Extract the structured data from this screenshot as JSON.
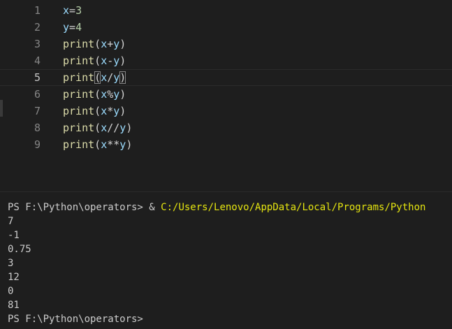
{
  "editor": {
    "active_line": 5,
    "lines": [
      {
        "number": "1",
        "tokens": [
          {
            "t": "x",
            "c": "v"
          },
          {
            "t": "=",
            "c": "o"
          },
          {
            "t": "3",
            "c": "n"
          }
        ]
      },
      {
        "number": "2",
        "tokens": [
          {
            "t": "y",
            "c": "v"
          },
          {
            "t": "=",
            "c": "o"
          },
          {
            "t": "4",
            "c": "n"
          }
        ]
      },
      {
        "number": "3",
        "tokens": [
          {
            "t": "print",
            "c": "f"
          },
          {
            "t": "(",
            "c": "p"
          },
          {
            "t": "x",
            "c": "v"
          },
          {
            "t": "+",
            "c": "o"
          },
          {
            "t": "y",
            "c": "v"
          },
          {
            "t": ")",
            "c": "p"
          }
        ]
      },
      {
        "number": "4",
        "tokens": [
          {
            "t": "print",
            "c": "f"
          },
          {
            "t": "(",
            "c": "p"
          },
          {
            "t": "x",
            "c": "v"
          },
          {
            "t": "-",
            "c": "o"
          },
          {
            "t": "y",
            "c": "v"
          },
          {
            "t": ")",
            "c": "p"
          }
        ]
      },
      {
        "number": "5",
        "tokens": [
          {
            "t": "print",
            "c": "f"
          },
          {
            "t": "(",
            "c": "p",
            "hl": true
          },
          {
            "t": "x",
            "c": "v"
          },
          {
            "t": "/",
            "c": "o"
          },
          {
            "t": "y",
            "c": "v"
          },
          {
            "t": ")",
            "c": "p",
            "hl": true
          }
        ]
      },
      {
        "number": "6",
        "tokens": [
          {
            "t": "print",
            "c": "f"
          },
          {
            "t": "(",
            "c": "p"
          },
          {
            "t": "x",
            "c": "v"
          },
          {
            "t": "%",
            "c": "o"
          },
          {
            "t": "y",
            "c": "v"
          },
          {
            "t": ")",
            "c": "p"
          }
        ]
      },
      {
        "number": "7",
        "tokens": [
          {
            "t": "print",
            "c": "f"
          },
          {
            "t": "(",
            "c": "p"
          },
          {
            "t": "x",
            "c": "v"
          },
          {
            "t": "*",
            "c": "o"
          },
          {
            "t": "y",
            "c": "v"
          },
          {
            "t": ")",
            "c": "p"
          }
        ]
      },
      {
        "number": "8",
        "tokens": [
          {
            "t": "print",
            "c": "f"
          },
          {
            "t": "(",
            "c": "p"
          },
          {
            "t": "x",
            "c": "v"
          },
          {
            "t": "//",
            "c": "o"
          },
          {
            "t": "y",
            "c": "v"
          },
          {
            "t": ")",
            "c": "p"
          }
        ]
      },
      {
        "number": "9",
        "tokens": [
          {
            "t": "print",
            "c": "f"
          },
          {
            "t": "(",
            "c": "p"
          },
          {
            "t": "x",
            "c": "v"
          },
          {
            "t": "**",
            "c": "o"
          },
          {
            "t": "y",
            "c": "v"
          },
          {
            "t": ")",
            "c": "p"
          }
        ]
      }
    ]
  },
  "terminal": {
    "prompt": "PS F:\\Python\\operators> ",
    "command_operator": "& ",
    "command_path": "C:/Users/Lenovo/AppData/Local/Programs/Python",
    "outputs": [
      "7",
      "-1",
      "0.75",
      "3",
      "12",
      "0",
      "81"
    ],
    "final_prompt": "PS F:\\Python\\operators>"
  },
  "colors": {
    "background": "#1e1e1e",
    "variable": "#9cdcfe",
    "function": "#dcdcaa",
    "number": "#b5cea8",
    "path": "#e5e510"
  }
}
